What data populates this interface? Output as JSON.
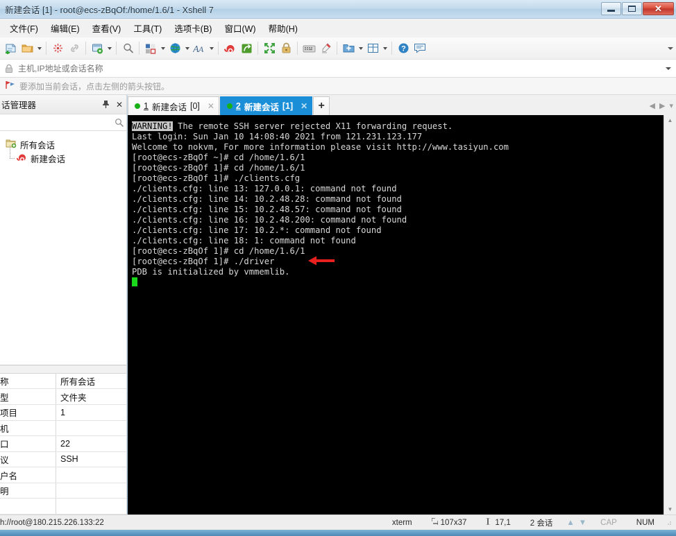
{
  "window": {
    "title": "新建会话 [1] - root@ecs-zBqOf:/home/1.6/1 - Xshell 7",
    "minimize_label": "最小化",
    "maximize_label": "最大化",
    "close_label": "✕"
  },
  "menubar": {
    "items": [
      {
        "label": "文件(F)",
        "name": "menu-file"
      },
      {
        "label": "编辑(E)",
        "name": "menu-edit"
      },
      {
        "label": "查看(V)",
        "name": "menu-view"
      },
      {
        "label": "工具(T)",
        "name": "menu-tools"
      },
      {
        "label": "选项卡(B)",
        "name": "menu-tabs"
      },
      {
        "label": "窗口(W)",
        "name": "menu-window"
      },
      {
        "label": "帮助(H)",
        "name": "menu-help"
      }
    ]
  },
  "toolbar": {
    "icons": [
      "new-session-icon",
      "open-folder-icon",
      "disconnect-icon",
      "link-icon",
      "session-properties-icon",
      "find-icon",
      "layout-icon",
      "globe-icon",
      "font-icon",
      "snail-icon",
      "green-transfer-icon",
      "fullscreen-icon",
      "lock-icon",
      "keyboard-icon",
      "highlight-pen-icon",
      "add-folder-icon",
      "split-view-icon",
      "help-icon",
      "chat-icon"
    ],
    "overflow_label": "更多"
  },
  "addressbar": {
    "placeholder": "主机,IP地址或会话名称",
    "value": "",
    "lock_icon": "lock-icon",
    "dropdown_icon": "chevron-down-icon"
  },
  "notice": {
    "icon": "bookmark-flag-icon",
    "text": "要添加当前会话，点击左侧的箭头按钮。"
  },
  "sidebar": {
    "title": "话管理器",
    "pin_icon": "pin-icon",
    "close_icon": "close-icon",
    "search": {
      "placeholder": "",
      "value": "",
      "icon": "search-icon"
    },
    "tree": [
      {
        "label": "所有会话",
        "icon": "folder-sessions-icon",
        "level": 0
      },
      {
        "label": "新建会话",
        "icon": "snail-session-icon",
        "level": 1
      }
    ],
    "properties": [
      {
        "key": "称",
        "value": "所有会话"
      },
      {
        "key": "型",
        "value": "文件夹"
      },
      {
        "key": "项目",
        "value": "1"
      },
      {
        "key": "机",
        "value": ""
      },
      {
        "key": "口",
        "value": "22"
      },
      {
        "key": "议",
        "value": "SSH"
      },
      {
        "key": "户名",
        "value": ""
      },
      {
        "key": "明",
        "value": ""
      }
    ]
  },
  "tabs": {
    "items": [
      {
        "num": "1",
        "label": "新建会话",
        "suffix": "[0]",
        "active": false,
        "close_icon": "close-icon",
        "status_icon": "connected-dot-icon"
      },
      {
        "num": "2",
        "label": "新建会话",
        "suffix": "[1]",
        "active": true,
        "close_icon": "close-icon",
        "status_icon": "connected-dot-icon"
      }
    ],
    "add_label": "+",
    "nav_prev": "◀",
    "nav_next": "▶",
    "nav_menu": "▾"
  },
  "terminal": {
    "warning_tag": "WARNING!",
    "lines": [
      " The remote SSH server rejected X11 forwarding request.",
      "Last login: Sun Jan 10 14:08:40 2021 from 121.231.123.177",
      "Welcome to nokvm, For more information please visit http://www.tasiyun.com",
      "[root@ecs-zBqOf ~]# cd /home/1.6/1",
      "[root@ecs-zBqOf 1]# cd /home/1.6/1",
      "[root@ecs-zBqOf 1]# ./clients.cfg",
      "./clients.cfg: line 13: 127.0.0.1: command not found",
      "./clients.cfg: line 14: 10.2.48.28: command not found",
      "./clients.cfg: line 15: 10.2.48.57: command not found",
      "./clients.cfg: line 16: 10.2.48.200: command not found",
      "./clients.cfg: line 17: 10.2.*: command not found",
      "./clients.cfg: line 18: 1: command not found",
      "[root@ecs-zBqOf 1]# cd /home/1.6/1",
      "[root@ecs-zBqOf 1]# ./driver",
      "PDB is initialized by vmmemlib."
    ],
    "annotation": {
      "type": "red-arrow",
      "color": "#e8201f",
      "points_to": "cd /home/1.6/1"
    },
    "cursor_color": "#1ad81a",
    "background": "#000000",
    "foreground": "#d8d8d8"
  },
  "statusbar": {
    "connection": "h://root@180.215.226.133:22",
    "term_type": "xterm",
    "size_icon": "size-icon",
    "size": "107x37",
    "cursor_icon": "cursor-icon",
    "cursor_pos": "17,1",
    "sessions": "2 会话",
    "up_arrow": "▲",
    "down_arrow": "▼",
    "cap": "CAP",
    "num": "NUM"
  }
}
